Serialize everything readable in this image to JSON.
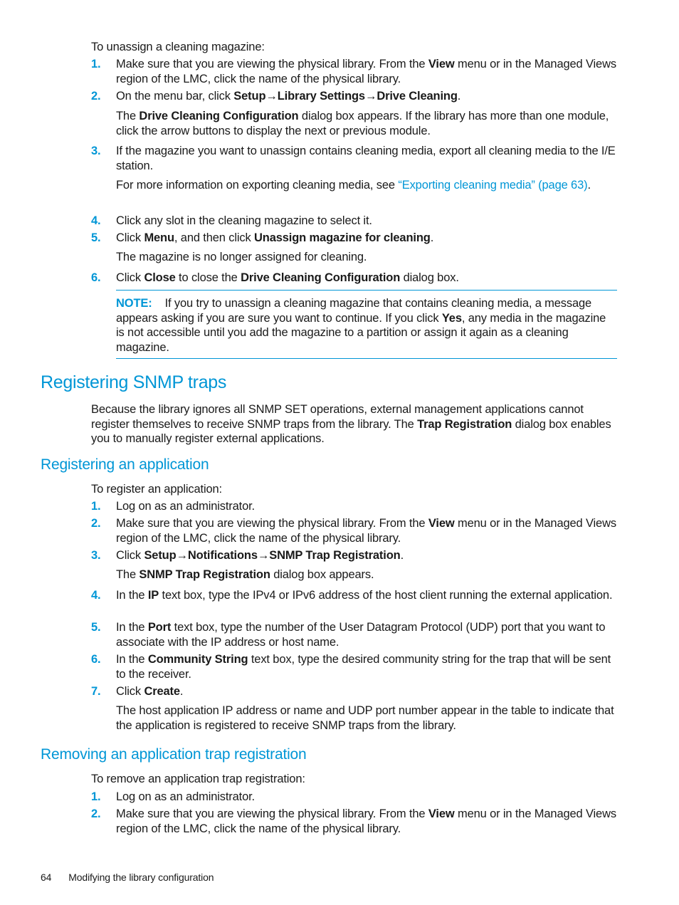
{
  "section_unassign": {
    "intro": "To unassign a cleaning magazine:",
    "steps": [
      {
        "num": "1.",
        "pre": "Make sure that you are viewing the physical library. From the ",
        "b1": "View",
        "post": " menu or in the Managed Views region of the LMC, click the name of the physical library."
      },
      {
        "num": "2.",
        "pre": "On the menu bar, click ",
        "b1": "Setup",
        "arrow1": "→",
        "b2": "Library Settings",
        "arrow2": "→",
        "b3": "Drive Cleaning",
        "post": ".",
        "sub": {
          "pre": "The ",
          "b1": "Drive Cleaning Configuration",
          "post": " dialog box appears. If the library has more than one module, click the arrow buttons to display the next or previous module."
        }
      },
      {
        "num": "3.",
        "text": "If the magazine you want to unassign contains cleaning media, export all cleaning media to the I/E station.",
        "sub": {
          "pre": "For more information on exporting cleaning media, see ",
          "link": "“Exporting cleaning media” (page 63)",
          "post": "."
        }
      },
      {
        "num": "4.",
        "text": "Click any slot in the cleaning magazine to select it."
      },
      {
        "num": "5.",
        "pre": "Click ",
        "b1": "Menu",
        "mid": ", and then click ",
        "b2": "Unassign magazine for cleaning",
        "post": ".",
        "sub": {
          "text": "The magazine is no longer assigned for cleaning."
        }
      },
      {
        "num": "6.",
        "pre": "Click ",
        "b1": "Close",
        "mid": " to close the ",
        "b2": "Drive Cleaning Configuration",
        "post": " dialog box."
      }
    ],
    "note": {
      "label": "NOTE:",
      "pre": "If you try to unassign a cleaning magazine that contains cleaning media, a message appears asking if you are sure you want to continue. If you click ",
      "b1": "Yes",
      "post": ", any media in the magazine is not accessible until you add the magazine to a partition or assign it again as a cleaning magazine."
    }
  },
  "section_snmp": {
    "title": "Registering SNMP traps",
    "para_pre": "Because the library ignores all SNMP SET operations, external management applications cannot register themselves to receive SNMP traps from the library. The ",
    "para_b": "Trap Registration",
    "para_post": " dialog box enables you to manually register external applications."
  },
  "section_register": {
    "title": "Registering an application",
    "intro": "To register an application:",
    "steps": [
      {
        "num": "1.",
        "text": "Log on as an administrator."
      },
      {
        "num": "2.",
        "pre": "Make sure that you are viewing the physical library. From the ",
        "b1": "View",
        "post": " menu or in the Managed Views region of the LMC, click the name of the physical library."
      },
      {
        "num": "3.",
        "pre": "Click ",
        "b1": "Setup",
        "arrow1": "→",
        "b2": "Notifications",
        "arrow2": "→",
        "b3": "SNMP Trap Registration",
        "post": ".",
        "sub": {
          "pre": "The ",
          "b1": "SNMP Trap Registration",
          "post": " dialog box appears."
        }
      },
      {
        "num": "4.",
        "pre": "In the ",
        "b1": "IP",
        "post": " text box, type the IPv4 or IPv6 address of the host client running the external application."
      },
      {
        "num": "5.",
        "pre": "In the ",
        "b1": "Port",
        "post": " text box, type the number of the User Datagram Protocol (UDP) port that you want to associate with the IP address or host name."
      },
      {
        "num": "6.",
        "pre": "In the ",
        "b1": "Community String",
        "post": " text box, type the desired community string for the trap that will be sent to the receiver."
      },
      {
        "num": "7.",
        "pre": "Click ",
        "b1": "Create",
        "post": ".",
        "sub": {
          "text": "The host application IP address or name and UDP port number appear in the table to indicate that the application is registered to receive SNMP traps from the library."
        }
      }
    ]
  },
  "section_remove": {
    "title": "Removing an application trap registration",
    "intro": "To remove an application trap registration:",
    "steps": [
      {
        "num": "1.",
        "text": "Log on as an administrator."
      },
      {
        "num": "2.",
        "pre": "Make sure that you are viewing the physical library. From the ",
        "b1": "View",
        "post": " menu or in the Managed Views region of the LMC, click the name of the physical library."
      }
    ]
  },
  "footer": {
    "page_number": "64",
    "chapter": "Modifying the library configuration"
  }
}
